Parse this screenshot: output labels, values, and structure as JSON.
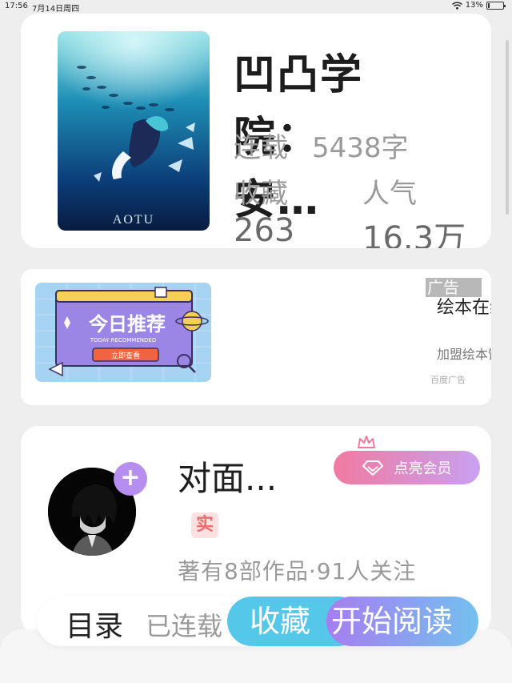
{
  "status_bar": {
    "time": "17:56",
    "date": "7月14日周四",
    "battery": "13%",
    "battery_level": 0.13
  },
  "book": {
    "title": "凹凸学院：安…",
    "status": "连载",
    "word_count": "5438字",
    "favorites_label": "收藏",
    "favorites_value": "263",
    "popularity_label": "人气",
    "popularity_value": "16.3万",
    "cover_text": "AOTU"
  },
  "ad": {
    "banner_title": "今日推荐",
    "banner_subtitle": "TODAY RECOMMENDED",
    "banner_button": "立即查看",
    "tag": "广告",
    "title": "绘本在线",
    "description": "加盟绘本馆大",
    "source": "百度广告"
  },
  "author": {
    "name": "对面...",
    "real_badge": "实",
    "stats": "著有8部作品·91人关注",
    "vip_label": "点亮会员",
    "follow_symbol": "+"
  },
  "actions": {
    "toc": "目录",
    "serial_status": "已连载",
    "collect": "收藏",
    "read": "开始阅读"
  },
  "colors": {
    "accent_purple": "#b58ef0",
    "collect_blue": "#55c8ea",
    "vip_pink": "#f07aa0",
    "badge_red": "#ef6a6a"
  }
}
